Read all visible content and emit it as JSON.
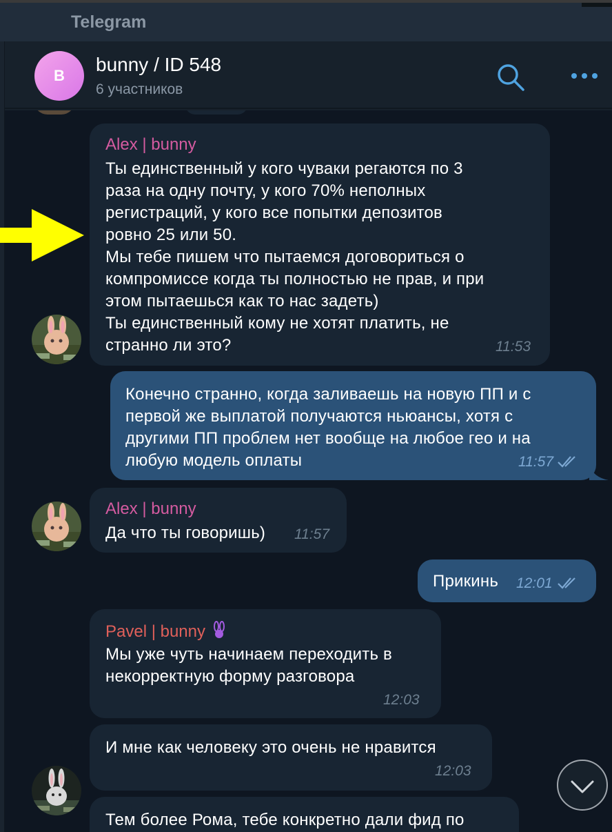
{
  "app": {
    "title": "Telegram"
  },
  "chat": {
    "avatar_letter": "B",
    "title": "bunny / ID 548",
    "subtitle": "6 участников"
  },
  "colors": {
    "accent": "#4fa3e0",
    "alex_name": "#d45ba0",
    "pavel_name": "#e0605a",
    "outgoing_bubble": "#2b5278",
    "incoming_bubble": "#182533"
  },
  "messages": [
    {
      "sender": "Alex | bunny",
      "text": "Ты единственный у кого чуваки регаются по 3\nраза на одну почту, у кого 70% неполных\nрегистраций, у кого все попытки депозитов\nровно 25 или 50.\nМы тебе пишем что пытаемся договориться о\nкомпромиссе когда ты полностью не прав, и при\nэтом пытаешься как то нас задеть)\nТы единственный кому не хотят платить, не\nстранно ли это?",
      "time": "11:53"
    },
    {
      "text": "Конечно странно, когда заливаешь на новую ПП и с\nпервой же выплатой получаются ньюансы, хотя с\nдругими ПП проблем нет вообще на любое гео и на\nлюбую модель оплаты",
      "time": "11:57"
    },
    {
      "sender": "Alex | bunny",
      "text": "Да что ты говоришь)",
      "time": "11:57"
    },
    {
      "text": "Прикинь",
      "time": "12:01"
    },
    {
      "sender": "Pavel | bunny",
      "sender_emoji": "🐰",
      "text": "Мы уже чуть начинаем переходить в\nнекорректную форму разговора",
      "time": "12:03"
    },
    {
      "text": "И мне как человеку это очень не нравится",
      "time": "12:03"
    },
    {
      "text": "Тем более Рома, тебе конкретно дали фид по"
    }
  ],
  "icons": {
    "search": "search-icon",
    "more": "more-icon",
    "scroll_down": "chevron-down-icon",
    "annotation": "arrow-right-icon"
  }
}
